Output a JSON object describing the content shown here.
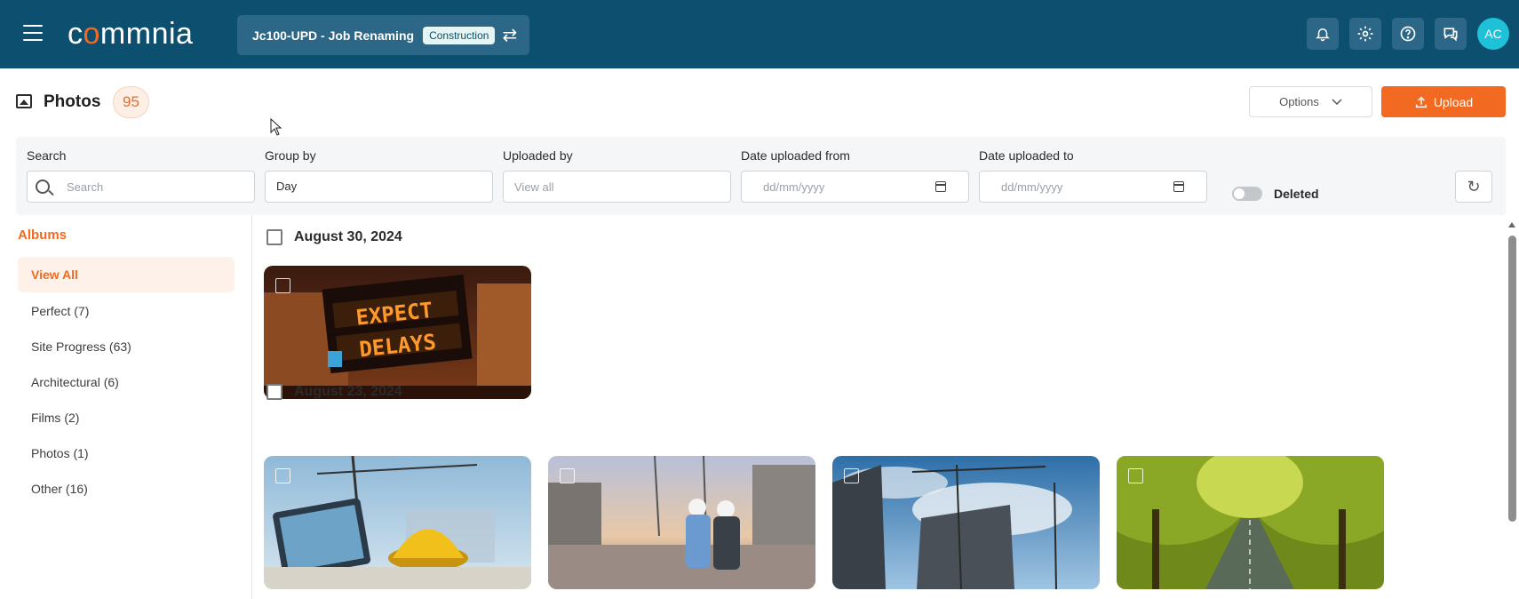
{
  "header": {
    "brand": "commnia",
    "job_name": "Jc100-UPD - Job Renaming",
    "job_tag": "Construction",
    "avatar_initials": "AC",
    "icons": [
      "menu-icon",
      "bell-icon",
      "gear-icon",
      "help-icon",
      "chat-icon"
    ]
  },
  "page": {
    "title": "Photos",
    "count": "95",
    "options_label": "Options",
    "upload_label": "Upload"
  },
  "filters": {
    "search_label": "Search",
    "search_placeholder": "Search",
    "group_label": "Group by",
    "group_value": "Day",
    "uploaded_by_label": "Uploaded by",
    "uploaded_by_placeholder": "View all",
    "date_from_label": "Date uploaded from",
    "date_from_placeholder": "dd/mm/yyyy",
    "date_to_label": "Date uploaded to",
    "date_to_placeholder": "dd/mm/yyyy",
    "deleted_label": "Deleted",
    "deleted_on": false
  },
  "albums": {
    "title": "Albums",
    "items": [
      {
        "label": "View All",
        "active": true
      },
      {
        "label": "Perfect (7)"
      },
      {
        "label": "Site Progress (63)"
      },
      {
        "label": "Architectural (6)"
      },
      {
        "label": "Films (2)"
      },
      {
        "label": "Photos (1)"
      },
      {
        "label": "Other (16)"
      }
    ]
  },
  "groups": [
    {
      "date": "August 30, 2024",
      "photos": [
        {
          "name": "expect-delays-sign-photo"
        }
      ]
    },
    {
      "date": "August 23, 2024",
      "photos": [
        {
          "name": "tablet-helmet-blueprints-photo"
        },
        {
          "name": "engineers-on-site-photo"
        },
        {
          "name": "cranes-building-photo"
        },
        {
          "name": "tree-lined-road-photo"
        }
      ]
    }
  ],
  "colors": {
    "header_bg": "#0d4f6e",
    "accent": "#f26a21",
    "avatar": "#1fc1d9"
  }
}
